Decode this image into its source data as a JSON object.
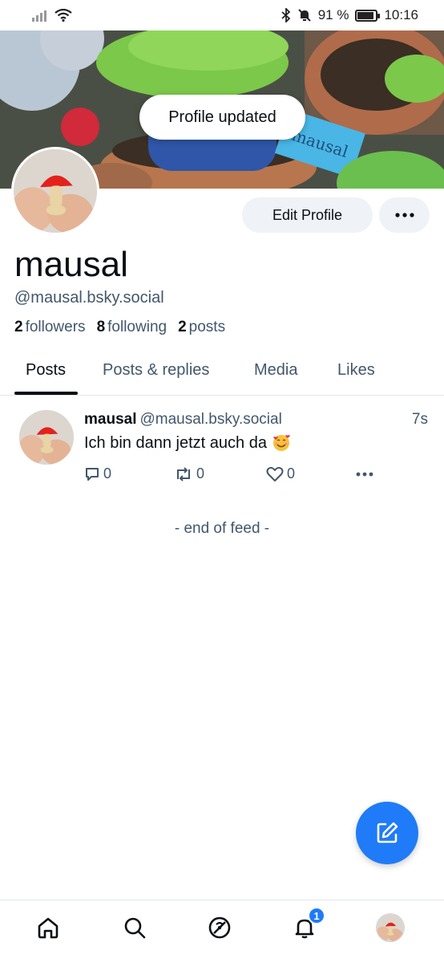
{
  "status_bar": {
    "battery_text": "91 %",
    "battery_level": 0.91,
    "time": "10:16"
  },
  "toast": {
    "text": "Profile updated"
  },
  "banner": {
    "sign_text": "mausal"
  },
  "profile": {
    "edit_label": "Edit Profile",
    "display_name": "mausal",
    "handle": "@mausal.bsky.social",
    "stats": {
      "followers_count": "2",
      "followers_label": "followers",
      "following_count": "8",
      "following_label": "following",
      "posts_count": "2",
      "posts_label": "posts"
    }
  },
  "tabs": [
    "Posts",
    "Posts & replies",
    "Media",
    "Likes"
  ],
  "post": {
    "author": "mausal",
    "handle": "@mausal.bsky.social",
    "time": "7s",
    "text": "Ich bin dann jetzt auch da",
    "emoji": "smiling-face-with-hearts",
    "replies": "0",
    "reposts": "0",
    "likes": "0"
  },
  "feed_end": "- end of feed -",
  "nav": {
    "notifications_badge": "1"
  },
  "colors": {
    "accent": "#1f7bf7",
    "text_muted": "#42576c"
  }
}
